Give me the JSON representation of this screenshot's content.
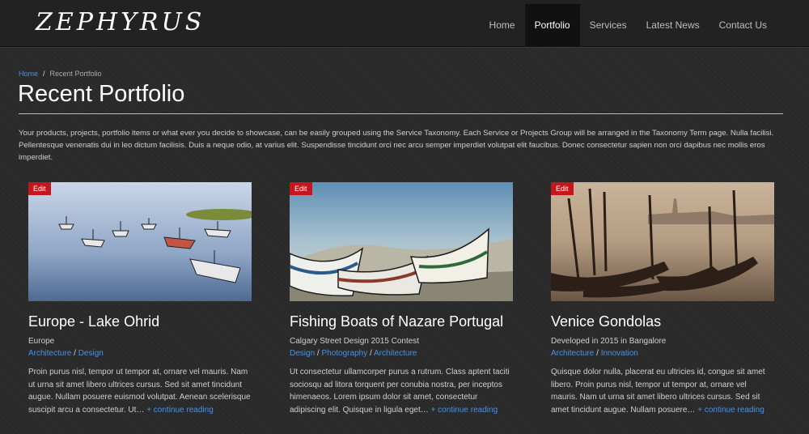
{
  "header": {
    "logo": "ZEPHYRUS",
    "nav": [
      {
        "label": "Home"
      },
      {
        "label": "Portfolio"
      },
      {
        "label": "Services"
      },
      {
        "label": "Latest News"
      },
      {
        "label": "Contact Us"
      }
    ],
    "active_nav": "Portfolio"
  },
  "breadcrumb": {
    "home": "Home",
    "separator": "/",
    "current": "Recent Portfolio"
  },
  "page": {
    "title": "Recent Portfolio",
    "intro": "Your products, projects, portfolio items or what ever you decide to showcase, can be easily grouped using the Service Taxonomy. Each Service or Projects Group will be arranged in the Taxonomy Term page. Nulla facilisi. Pellentesque venenatis dui in leo dictum facilisis. Duis a neque odio, at varius elit. Suspendisse tincidunt orci nec arcu semper imperdiet volutpat elit faucibus. Donec consectetur sapien non orci dapibus nec mollis eros imperdiet."
  },
  "cards": [
    {
      "edit": "Edit",
      "title": "Europe - Lake Ohrid",
      "subtitle": "Europe",
      "cat1": "Architecture",
      "cat_sep": " / ",
      "cat2": "Design",
      "cat3": "",
      "text": "Proin purus nisl, tempor ut tempor at, ornare vel mauris. Nam ut urna sit amet libero ultrices cursus. Sed sit amet tincidunt augue. Nullam posuere euismod volutpat. Aenean scelerisque suscipit arcu a consectetur. Ut…",
      "more": "+ continue reading"
    },
    {
      "edit": "Edit",
      "title": "Fishing Boats of Nazare Portugal",
      "subtitle": "Calgary Street Design 2015 Contest",
      "cat1": "Design",
      "cat_sep": " / ",
      "cat2": "Photography",
      "cat3": "Architecture",
      "text": "Ut consectetur ullamcorper purus a rutrum. Class aptent taciti sociosqu ad litora torquent per conubia nostra, per inceptos himenaeos. Lorem ipsum dolor sit amet, consectetur adipiscing elit. Quisque in ligula eget…",
      "more": "+ continue reading"
    },
    {
      "edit": "Edit",
      "title": "Venice Gondolas",
      "subtitle": "Developed in 2015 in Bangalore",
      "cat1": "Architecture",
      "cat_sep": " / ",
      "cat2": "Innovation",
      "cat3": "",
      "text": "Quisque dolor nulla, placerat eu ultricies id, congue sit amet libero. Proin purus nisl, tempor ut tempor at, ornare vel mauris. Nam ut urna sit amet libero ultrices cursus. Sed sit amet tincidunt augue. Nullam posuere…",
      "more": "+ continue reading"
    }
  ],
  "colors": {
    "accent": "#4a90e2",
    "edit_badge": "#c4161c",
    "background": "#2a2a2a"
  }
}
